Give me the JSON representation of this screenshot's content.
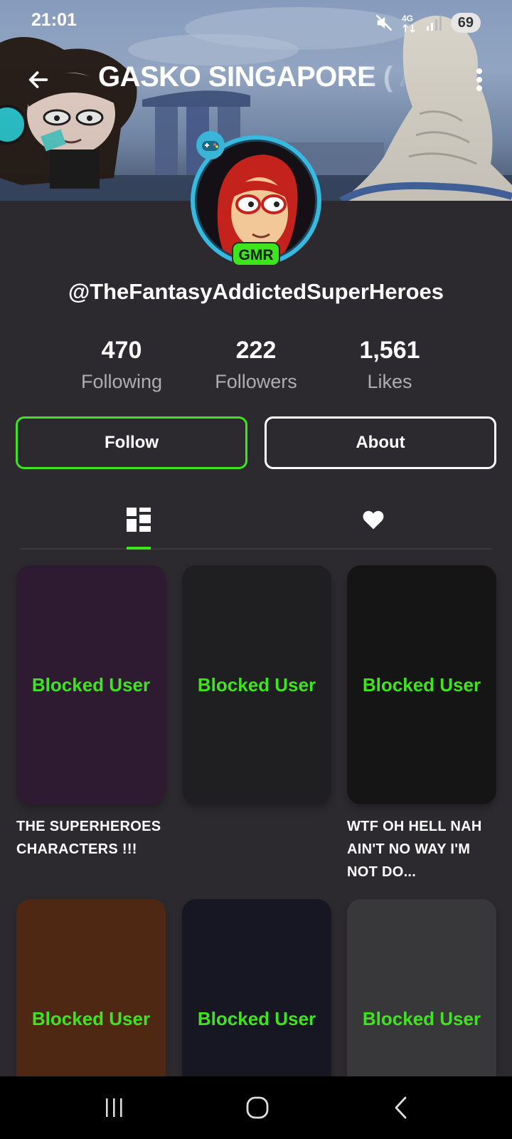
{
  "status_bar": {
    "time": "21:01",
    "network": "4G",
    "battery": "69",
    "icons": [
      "mute-icon",
      "network-4g-icon",
      "signal-icon",
      "battery-icon"
    ]
  },
  "header": {
    "title": "GASKO SINGAPORE ( A",
    "back_icon": "arrow-left-icon",
    "more_icon": "more-vertical-icon"
  },
  "profile": {
    "badge": "GMR",
    "username": "@TheFantasyAddictedSuperHeroes",
    "stats": [
      {
        "value": "470",
        "label": "Following"
      },
      {
        "value": "222",
        "label": "Followers"
      },
      {
        "value": "1,561",
        "label": "Likes"
      }
    ]
  },
  "actions": {
    "follow_label": "Follow",
    "about_label": "About"
  },
  "tabs": {
    "items": [
      {
        "icon": "grid-icon",
        "active": true
      },
      {
        "icon": "heart-icon",
        "active": false
      }
    ]
  },
  "posts": [
    {
      "label": "Blocked User",
      "caption": "THE SUPERHEROES CHARACTERS !!!",
      "color": "#2e1a31"
    },
    {
      "label": "Blocked User",
      "caption": "",
      "color": "#1f1e20"
    },
    {
      "label": "Blocked User",
      "caption": "WTF OH HELL NAH AIN'T NO WAY I'M NOT DO...",
      "color": "#151515"
    },
    {
      "label": "Blocked User",
      "caption": "",
      "color": "#4f2814"
    },
    {
      "label": "Blocked User",
      "caption": "",
      "color": "#161722"
    },
    {
      "label": "Blocked User",
      "caption": "",
      "color": "#38383a"
    }
  ],
  "colors": {
    "accent": "#3ee51f",
    "background": "#2c2a2e",
    "avatar_ring": "#38b9e0"
  },
  "nav": {
    "icons": [
      "recent-apps-icon",
      "home-icon",
      "back-icon"
    ]
  }
}
